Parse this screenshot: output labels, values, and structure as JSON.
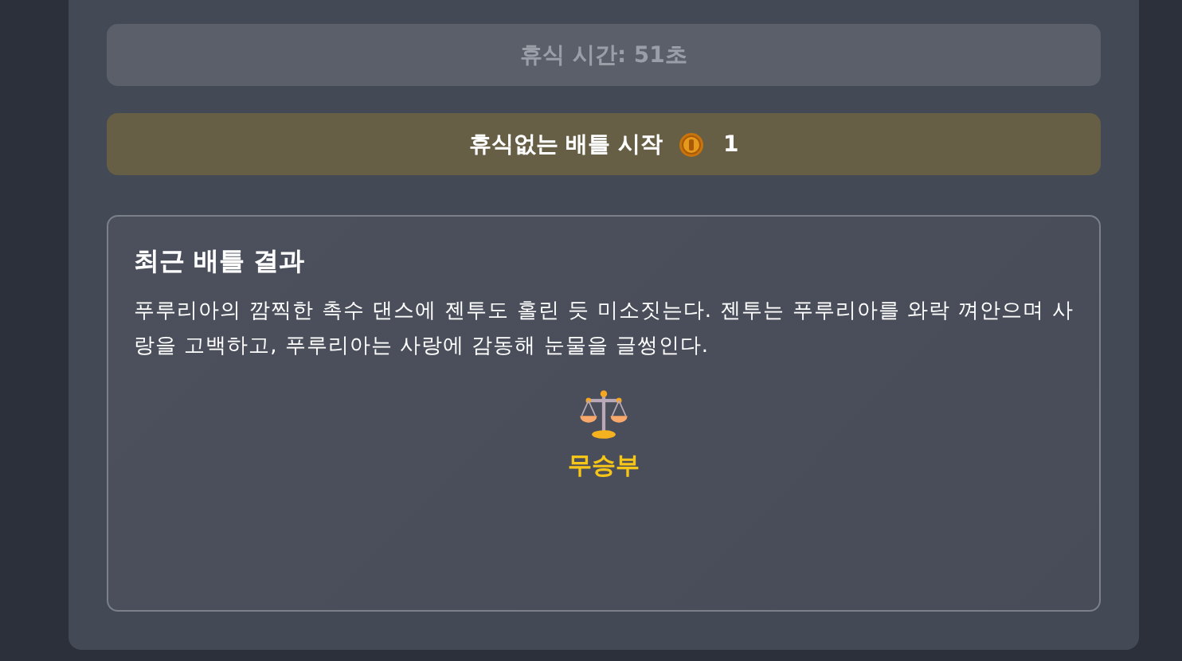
{
  "rest_button": {
    "label": "휴식 시간: 51초",
    "disabled": true
  },
  "battle_button": {
    "label": "휴식없는 배틀 시작",
    "cost": "1",
    "disabled": false
  },
  "recent_battle": {
    "title": "최근 배틀 결과",
    "description": "푸루리아의 깜찍한 촉수 댄스에 젠투도 홀린 듯 미소짓는다. 젠투는 푸루리아를 와락 껴안으며 사랑을 고백하고, 푸루리아는 사랑에 감동해 눈물을 글썽인다.",
    "outcome": {
      "kind": "draw",
      "label": "무승부"
    }
  }
}
